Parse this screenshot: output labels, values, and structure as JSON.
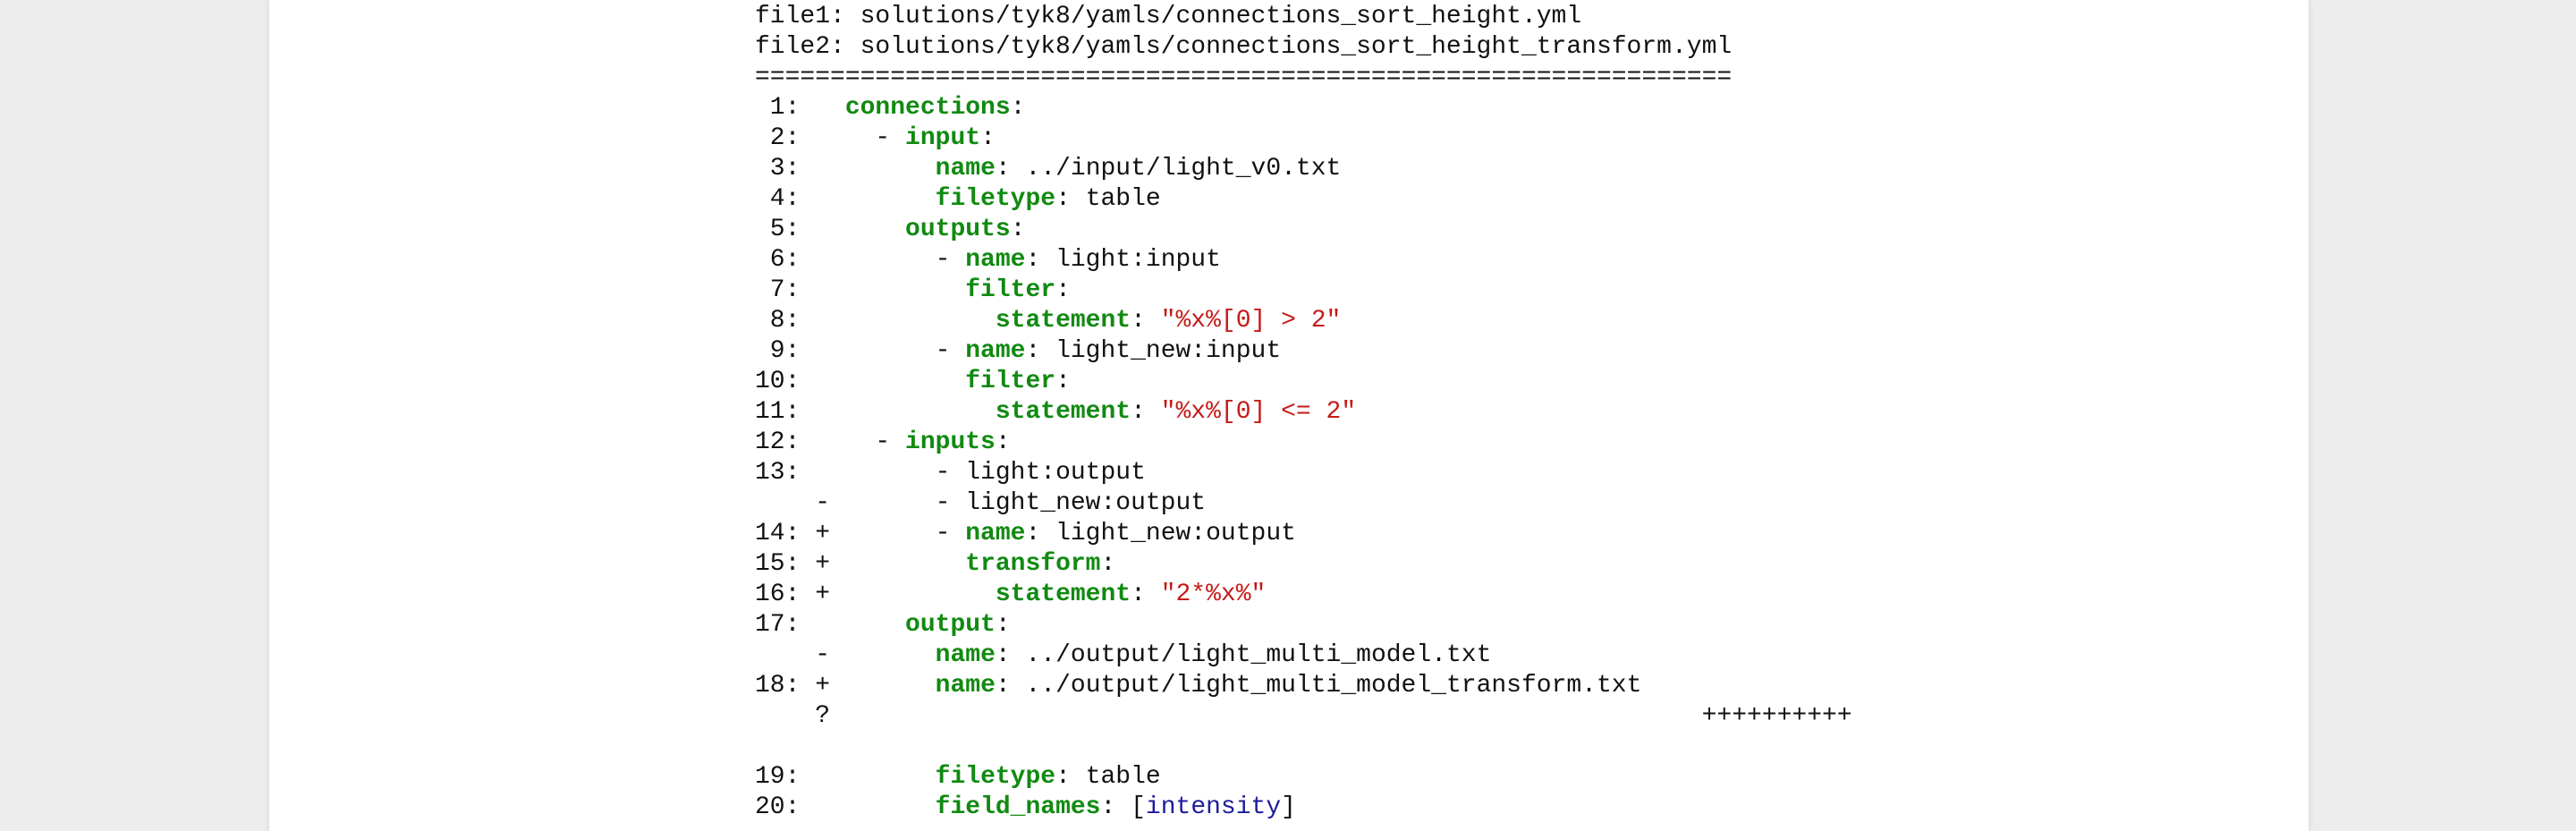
{
  "header": {
    "file1": "file1: solutions/tyk8/yamls/connections_sort_height.yml",
    "file2": "file2: solutions/tyk8/yamls/connections_sort_height_transform.yml",
    "separator": "================================================================="
  },
  "diff": {
    "lines": [
      {
        "prefix": " 1:   ",
        "indent": "",
        "key": "connections",
        "sep": ":",
        "value": "",
        "value_type": "plain"
      },
      {
        "prefix": " 2:   ",
        "indent": "  - ",
        "key": "input",
        "sep": ":",
        "value": "",
        "value_type": "plain"
      },
      {
        "prefix": " 3:   ",
        "indent": "      ",
        "key": "name",
        "sep": ": ",
        "value": "../input/light_v0.txt",
        "value_type": "plain"
      },
      {
        "prefix": " 4:   ",
        "indent": "      ",
        "key": "filetype",
        "sep": ": ",
        "value": "table",
        "value_type": "plain"
      },
      {
        "prefix": " 5:   ",
        "indent": "    ",
        "key": "outputs",
        "sep": ":",
        "value": "",
        "value_type": "plain"
      },
      {
        "prefix": " 6:   ",
        "indent": "      - ",
        "key": "name",
        "sep": ": ",
        "value": "light:input",
        "value_type": "plain"
      },
      {
        "prefix": " 7:   ",
        "indent": "        ",
        "key": "filter",
        "sep": ":",
        "value": "",
        "value_type": "plain"
      },
      {
        "prefix": " 8:   ",
        "indent": "          ",
        "key": "statement",
        "sep": ": ",
        "value": "\"%x%[0] > 2\"",
        "value_type": "string"
      },
      {
        "prefix": " 9:   ",
        "indent": "      - ",
        "key": "name",
        "sep": ": ",
        "value": "light_new:input",
        "value_type": "plain"
      },
      {
        "prefix": "10:   ",
        "indent": "        ",
        "key": "filter",
        "sep": ":",
        "value": "",
        "value_type": "plain"
      },
      {
        "prefix": "11:   ",
        "indent": "          ",
        "key": "statement",
        "sep": ": ",
        "value": "\"%x%[0] <= 2\"",
        "value_type": "string"
      },
      {
        "prefix": "12:   ",
        "indent": "  - ",
        "key": "inputs",
        "sep": ":",
        "value": "",
        "value_type": "plain"
      },
      {
        "prefix": "13:   ",
        "indent": "      - ",
        "key": "",
        "sep": "",
        "value": "light:output",
        "value_type": "plain"
      },
      {
        "prefix": "    - ",
        "indent": "      - ",
        "key": "",
        "sep": "",
        "value": "light_new:output",
        "value_type": "plain"
      },
      {
        "prefix": "14: + ",
        "indent": "      - ",
        "key": "name",
        "sep": ": ",
        "value": "light_new:output",
        "value_type": "plain"
      },
      {
        "prefix": "15: + ",
        "indent": "        ",
        "key": "transform",
        "sep": ":",
        "value": "",
        "value_type": "plain"
      },
      {
        "prefix": "16: + ",
        "indent": "          ",
        "key": "statement",
        "sep": ": ",
        "value": "\"2*%x%\"",
        "value_type": "string"
      },
      {
        "prefix": "17:   ",
        "indent": "    ",
        "key": "output",
        "sep": ":",
        "value": "",
        "value_type": "plain"
      },
      {
        "prefix": "    - ",
        "indent": "      ",
        "key": "name",
        "sep": ": ",
        "value": "../output/light_multi_model.txt",
        "value_type": "plain"
      },
      {
        "prefix": "18: + ",
        "indent": "      ",
        "key": "name",
        "sep": ": ",
        "value": "../output/light_multi_model_transform.txt",
        "value_type": "plain"
      },
      {
        "prefix": "    ? ",
        "indent": "",
        "key": "",
        "sep": "",
        "value": "                                                         ++++++++++",
        "value_type": "plain"
      },
      {
        "prefix": "",
        "indent": "",
        "key": "",
        "sep": "",
        "value": "",
        "value_type": "plain"
      },
      {
        "prefix": "19:   ",
        "indent": "      ",
        "key": "filetype",
        "sep": ": ",
        "value": "table",
        "value_type": "plain"
      },
      {
        "prefix": "20:   ",
        "indent": "      ",
        "key": "field_names",
        "sep": ": [",
        "value": "intensity",
        "value_type": "list",
        "suffix": "]"
      }
    ]
  },
  "colors": {
    "key": "#118a11",
    "string": "#c41a16",
    "list_item": "#1c1c9c",
    "text": "#111111",
    "background": "#ededed",
    "page": "#ffffff"
  }
}
